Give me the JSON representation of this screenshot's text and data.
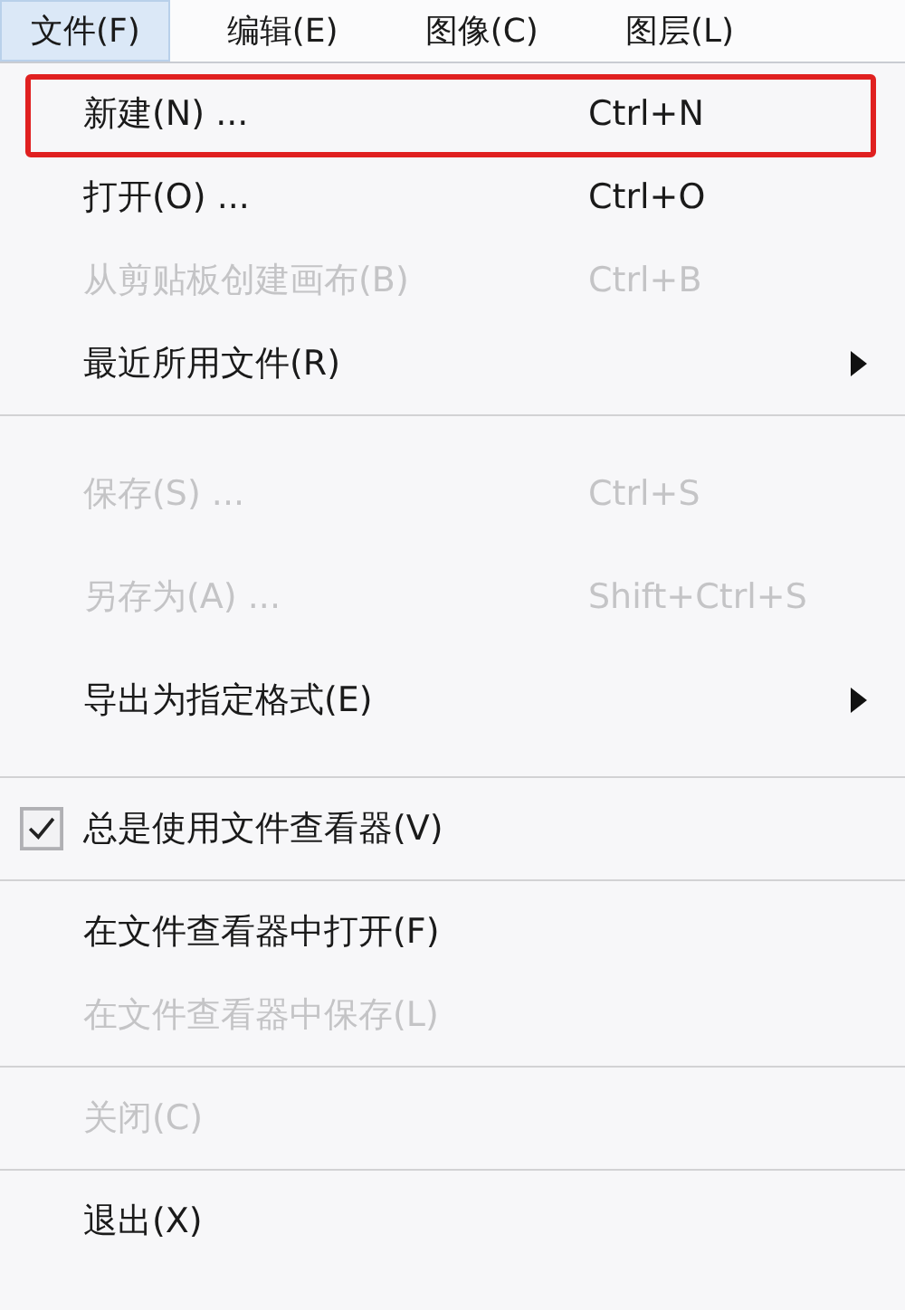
{
  "menubar": [
    {
      "label": "文件(F)",
      "selected": true
    },
    {
      "label": "编辑(E)",
      "selected": false
    },
    {
      "label": "图像(C)",
      "selected": false
    },
    {
      "label": "图层(L)",
      "selected": false
    }
  ],
  "menu": {
    "sections": [
      {
        "items": [
          {
            "label": "新建(N) ...",
            "shortcut": "Ctrl+N",
            "disabled": false,
            "checked": false,
            "submenu": false,
            "highlighted": true
          },
          {
            "label": "打开(O) ...",
            "shortcut": "Ctrl+O",
            "disabled": false,
            "checked": false,
            "submenu": false,
            "highlighted": false
          },
          {
            "label": "从剪贴板创建画布(B)",
            "shortcut": "Ctrl+B",
            "disabled": true,
            "checked": false,
            "submenu": false,
            "highlighted": false
          },
          {
            "label": "最近所用文件(R)",
            "disabled": false,
            "checked": false,
            "submenu": true,
            "highlighted": false
          }
        ]
      },
      {
        "items": [
          {
            "label": "保存(S) ...",
            "shortcut": "Ctrl+S",
            "disabled": true,
            "checked": false,
            "submenu": false,
            "highlighted": false
          },
          {
            "label": "另存为(A) ...",
            "shortcut": "Shift+Ctrl+S",
            "disabled": true,
            "checked": false,
            "submenu": false,
            "highlighted": false
          },
          {
            "label": "导出为指定格式(E)",
            "disabled": false,
            "checked": false,
            "submenu": true,
            "highlighted": false
          }
        ]
      },
      {
        "items": [
          {
            "label": "总是使用文件查看器(V)",
            "disabled": false,
            "checked": true,
            "submenu": false,
            "highlighted": false
          }
        ]
      },
      {
        "items": [
          {
            "label": "在文件查看器中打开(F)",
            "disabled": false,
            "checked": false,
            "submenu": false,
            "highlighted": false
          },
          {
            "label": "在文件查看器中保存(L)",
            "disabled": true,
            "checked": false,
            "submenu": false,
            "highlighted": false
          }
        ]
      },
      {
        "items": [
          {
            "label": "关闭(C)",
            "disabled": true,
            "checked": false,
            "submenu": false,
            "highlighted": false
          }
        ]
      },
      {
        "items": [
          {
            "label": "退出(X)",
            "disabled": false,
            "checked": false,
            "submenu": false,
            "highlighted": false
          }
        ]
      }
    ]
  }
}
